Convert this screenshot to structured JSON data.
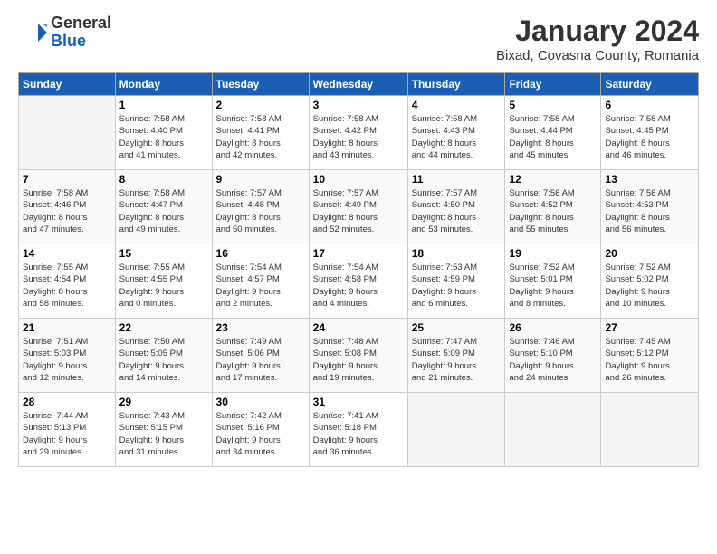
{
  "logo": {
    "general": "General",
    "blue": "Blue"
  },
  "title": {
    "month": "January 2024",
    "location": "Bixad, Covasna County, Romania"
  },
  "weekdays": [
    "Sunday",
    "Monday",
    "Tuesday",
    "Wednesday",
    "Thursday",
    "Friday",
    "Saturday"
  ],
  "weeks": [
    [
      {
        "day": "",
        "info": ""
      },
      {
        "day": "1",
        "info": "Sunrise: 7:58 AM\nSunset: 4:40 PM\nDaylight: 8 hours\nand 41 minutes."
      },
      {
        "day": "2",
        "info": "Sunrise: 7:58 AM\nSunset: 4:41 PM\nDaylight: 8 hours\nand 42 minutes."
      },
      {
        "day": "3",
        "info": "Sunrise: 7:58 AM\nSunset: 4:42 PM\nDaylight: 8 hours\nand 43 minutes."
      },
      {
        "day": "4",
        "info": "Sunrise: 7:58 AM\nSunset: 4:43 PM\nDaylight: 8 hours\nand 44 minutes."
      },
      {
        "day": "5",
        "info": "Sunrise: 7:58 AM\nSunset: 4:44 PM\nDaylight: 8 hours\nand 45 minutes."
      },
      {
        "day": "6",
        "info": "Sunrise: 7:58 AM\nSunset: 4:45 PM\nDaylight: 8 hours\nand 46 minutes."
      }
    ],
    [
      {
        "day": "7",
        "info": "Sunrise: 7:58 AM\nSunset: 4:46 PM\nDaylight: 8 hours\nand 47 minutes."
      },
      {
        "day": "8",
        "info": "Sunrise: 7:58 AM\nSunset: 4:47 PM\nDaylight: 8 hours\nand 49 minutes."
      },
      {
        "day": "9",
        "info": "Sunrise: 7:57 AM\nSunset: 4:48 PM\nDaylight: 8 hours\nand 50 minutes."
      },
      {
        "day": "10",
        "info": "Sunrise: 7:57 AM\nSunset: 4:49 PM\nDaylight: 8 hours\nand 52 minutes."
      },
      {
        "day": "11",
        "info": "Sunrise: 7:57 AM\nSunset: 4:50 PM\nDaylight: 8 hours\nand 53 minutes."
      },
      {
        "day": "12",
        "info": "Sunrise: 7:56 AM\nSunset: 4:52 PM\nDaylight: 8 hours\nand 55 minutes."
      },
      {
        "day": "13",
        "info": "Sunrise: 7:56 AM\nSunset: 4:53 PM\nDaylight: 8 hours\nand 56 minutes."
      }
    ],
    [
      {
        "day": "14",
        "info": "Sunrise: 7:55 AM\nSunset: 4:54 PM\nDaylight: 8 hours\nand 58 minutes."
      },
      {
        "day": "15",
        "info": "Sunrise: 7:55 AM\nSunset: 4:55 PM\nDaylight: 9 hours\nand 0 minutes."
      },
      {
        "day": "16",
        "info": "Sunrise: 7:54 AM\nSunset: 4:57 PM\nDaylight: 9 hours\nand 2 minutes."
      },
      {
        "day": "17",
        "info": "Sunrise: 7:54 AM\nSunset: 4:58 PM\nDaylight: 9 hours\nand 4 minutes."
      },
      {
        "day": "18",
        "info": "Sunrise: 7:53 AM\nSunset: 4:59 PM\nDaylight: 9 hours\nand 6 minutes."
      },
      {
        "day": "19",
        "info": "Sunrise: 7:52 AM\nSunset: 5:01 PM\nDaylight: 9 hours\nand 8 minutes."
      },
      {
        "day": "20",
        "info": "Sunrise: 7:52 AM\nSunset: 5:02 PM\nDaylight: 9 hours\nand 10 minutes."
      }
    ],
    [
      {
        "day": "21",
        "info": "Sunrise: 7:51 AM\nSunset: 5:03 PM\nDaylight: 9 hours\nand 12 minutes."
      },
      {
        "day": "22",
        "info": "Sunrise: 7:50 AM\nSunset: 5:05 PM\nDaylight: 9 hours\nand 14 minutes."
      },
      {
        "day": "23",
        "info": "Sunrise: 7:49 AM\nSunset: 5:06 PM\nDaylight: 9 hours\nand 17 minutes."
      },
      {
        "day": "24",
        "info": "Sunrise: 7:48 AM\nSunset: 5:08 PM\nDaylight: 9 hours\nand 19 minutes."
      },
      {
        "day": "25",
        "info": "Sunrise: 7:47 AM\nSunset: 5:09 PM\nDaylight: 9 hours\nand 21 minutes."
      },
      {
        "day": "26",
        "info": "Sunrise: 7:46 AM\nSunset: 5:10 PM\nDaylight: 9 hours\nand 24 minutes."
      },
      {
        "day": "27",
        "info": "Sunrise: 7:45 AM\nSunset: 5:12 PM\nDaylight: 9 hours\nand 26 minutes."
      }
    ],
    [
      {
        "day": "28",
        "info": "Sunrise: 7:44 AM\nSunset: 5:13 PM\nDaylight: 9 hours\nand 29 minutes."
      },
      {
        "day": "29",
        "info": "Sunrise: 7:43 AM\nSunset: 5:15 PM\nDaylight: 9 hours\nand 31 minutes."
      },
      {
        "day": "30",
        "info": "Sunrise: 7:42 AM\nSunset: 5:16 PM\nDaylight: 9 hours\nand 34 minutes."
      },
      {
        "day": "31",
        "info": "Sunrise: 7:41 AM\nSunset: 5:18 PM\nDaylight: 9 hours\nand 36 minutes."
      },
      {
        "day": "",
        "info": ""
      },
      {
        "day": "",
        "info": ""
      },
      {
        "day": "",
        "info": ""
      }
    ]
  ]
}
